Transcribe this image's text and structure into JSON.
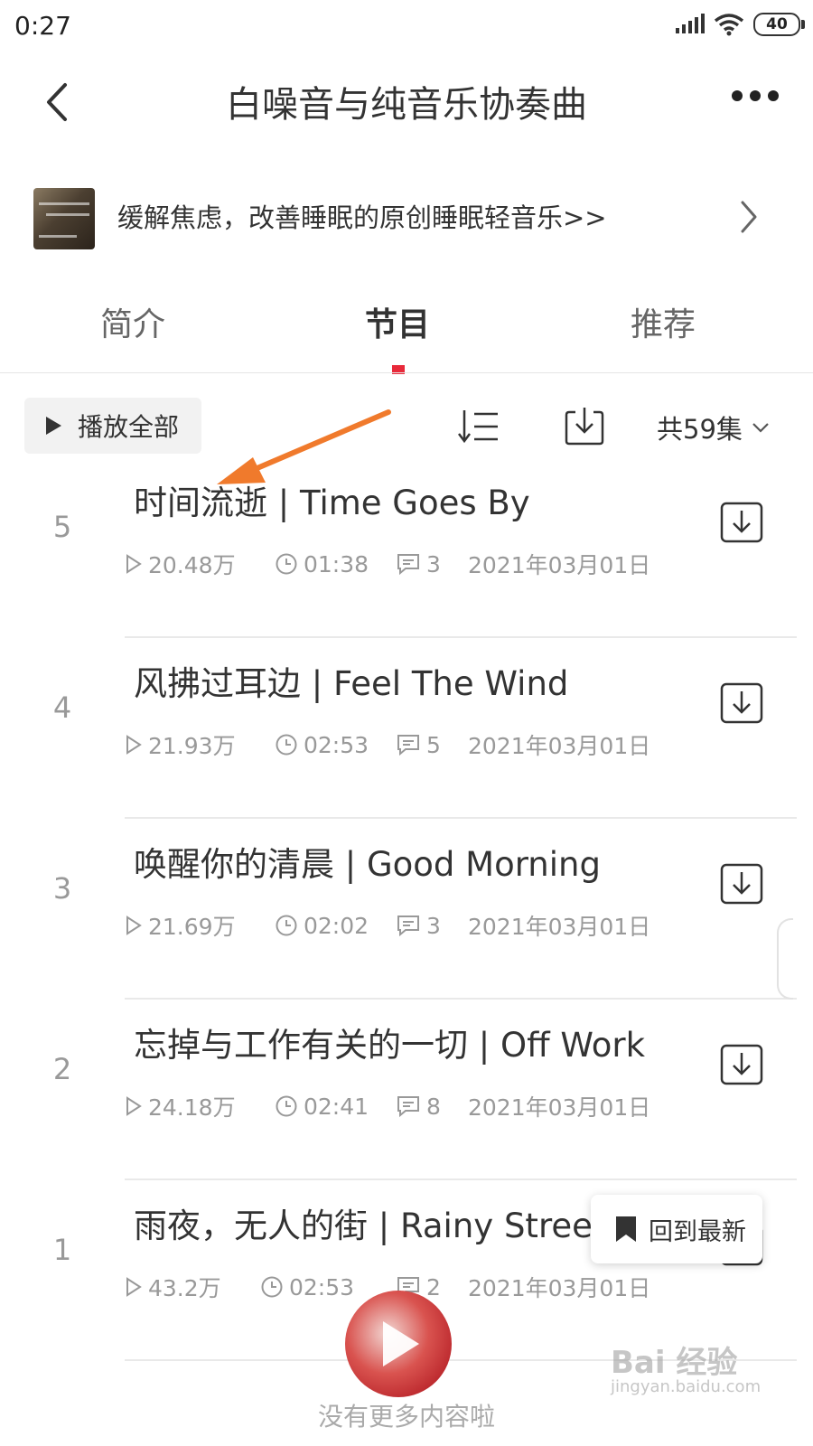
{
  "status_bar": {
    "time": "0:27",
    "battery": "40"
  },
  "header": {
    "title": "白噪音与纯音乐协奏曲"
  },
  "banner": {
    "text": "缓解焦虑，改善睡眠的原创睡眠轻音乐>>"
  },
  "tabs": [
    {
      "label": "简介",
      "active": false
    },
    {
      "label": "节目",
      "active": true
    },
    {
      "label": "推荐",
      "active": false
    }
  ],
  "toolbar": {
    "play_all_label": "播放全部",
    "count_label": "共59集"
  },
  "episodes": [
    {
      "number": "5",
      "title": "时间流逝 | Time Goes By",
      "plays": "20.48万",
      "duration": "01:38",
      "comments": "3",
      "date": "2021年03月01日"
    },
    {
      "number": "4",
      "title": "风拂过耳边 | Feel The Wind",
      "plays": "21.93万",
      "duration": "02:53",
      "comments": "5",
      "date": "2021年03月01日"
    },
    {
      "number": "3",
      "title": "唤醒你的清晨 | Good Morning",
      "plays": "21.69万",
      "duration": "02:02",
      "comments": "3",
      "date": "2021年03月01日"
    },
    {
      "number": "2",
      "title": "忘掉与工作有关的一切 |  Off Work",
      "plays": "24.18万",
      "duration": "02:41",
      "comments": "8",
      "date": "2021年03月01日"
    },
    {
      "number": "1",
      "title": "雨夜，无人的街 | Rainy Street",
      "plays": "43.2万",
      "duration": "02:53",
      "comments": "2",
      "date": "2021年03月01日"
    }
  ],
  "overlay": {
    "back_to_latest": "回到最新",
    "no_more": "没有更多内容啦"
  },
  "watermark": {
    "text": "Bai 经验",
    "url": "jingyan.baidu.com"
  },
  "colors": {
    "accent": "#e8293a",
    "annotation_arrow": "#f07a2c"
  }
}
